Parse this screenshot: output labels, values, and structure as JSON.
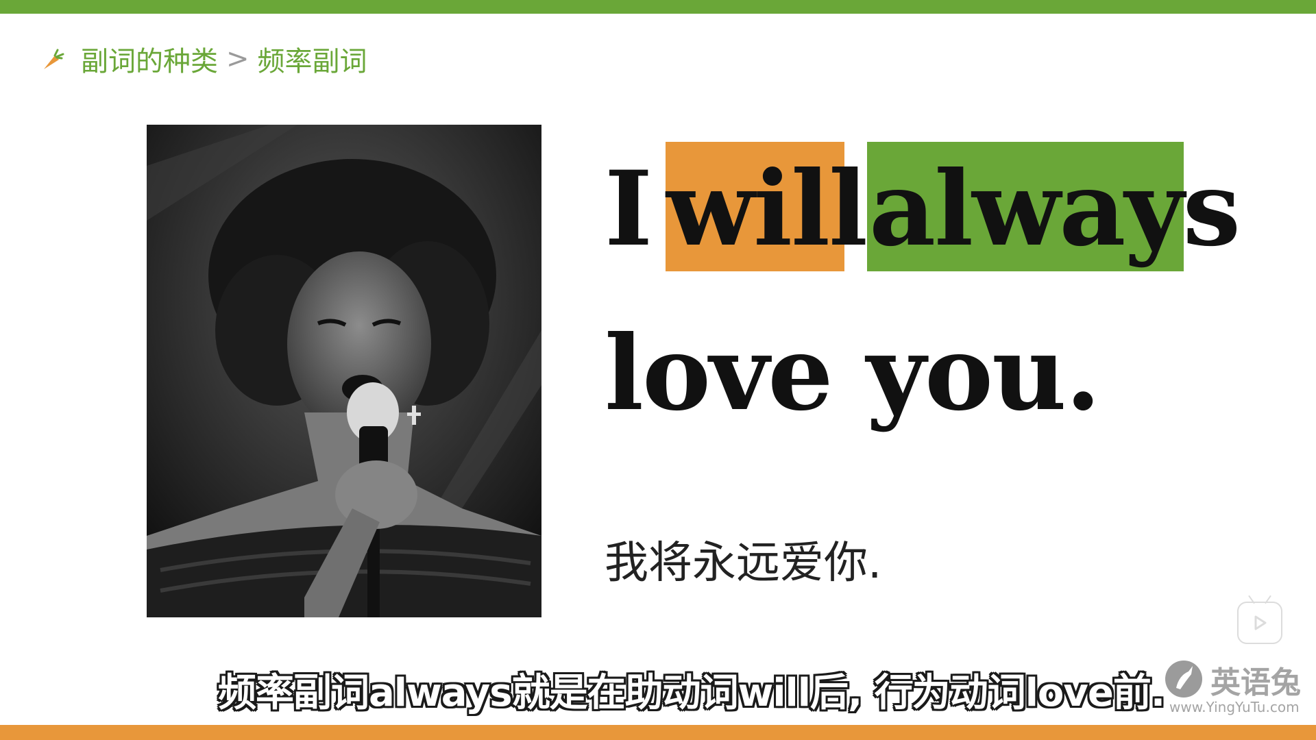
{
  "colors": {
    "green": "#6aa738",
    "orange": "#e8973a",
    "breadcrumb_text": "#6aa738",
    "breadcrumb_sep": "#9a9a9a",
    "watermark": "#9b9b9b"
  },
  "breadcrumb": {
    "icon": "carrot-icon",
    "parent": "副词的种类",
    "separator": ">",
    "current": "频率副词"
  },
  "photo": {
    "icon": "singer-photo"
  },
  "sentence": {
    "word_i": "I",
    "word_will": "will",
    "word_always": "always",
    "line2": "love you."
  },
  "translation": "我将永远爱你.",
  "subtitle": "频率副词always就是在助动词will后, 行为动词love前.",
  "watermark": {
    "icon": "rabbit-logo-icon",
    "name": "英语兔",
    "url": "www.YingYuTu.com"
  },
  "player": {
    "icon": "tv-play-icon"
  }
}
